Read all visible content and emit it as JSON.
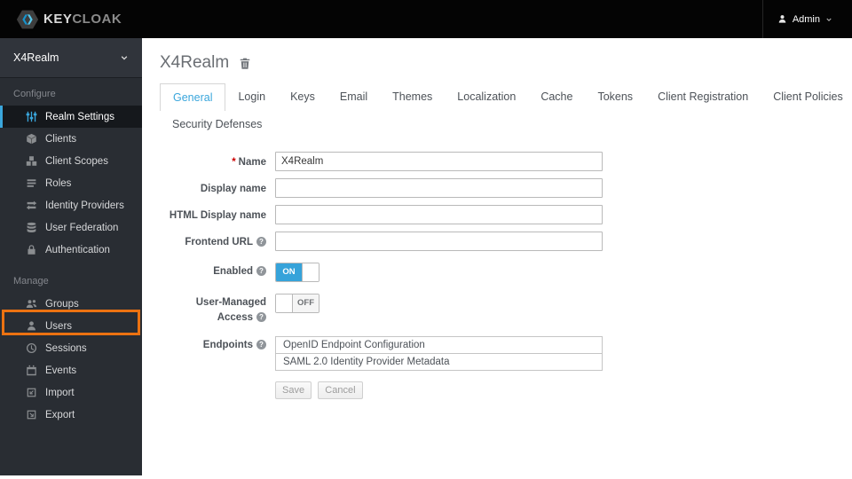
{
  "header": {
    "logo": {
      "icon": "keycloak-logo-icon",
      "text_primary": "KEY",
      "text_secondary": "CLOAK"
    },
    "user_menu": {
      "icon": "user-icon",
      "label": "Admin"
    }
  },
  "sidebar": {
    "realm_selector": {
      "label": "X4Realm"
    },
    "sections": [
      {
        "title": "Configure",
        "items": [
          {
            "label": "Realm Settings",
            "icon": "sliders-icon",
            "active": true
          },
          {
            "label": "Clients",
            "icon": "cube-icon"
          },
          {
            "label": "Client Scopes",
            "icon": "cubes-icon"
          },
          {
            "label": "Roles",
            "icon": "list-icon"
          },
          {
            "label": "Identity Providers",
            "icon": "exchange-arrows-icon"
          },
          {
            "label": "User Federation",
            "icon": "database-icon"
          },
          {
            "label": "Authentication",
            "icon": "lock-icon"
          }
        ]
      },
      {
        "title": "Manage",
        "items": [
          {
            "label": "Groups",
            "icon": "group-icon"
          },
          {
            "label": "Users",
            "icon": "user-icon",
            "highlighted": true
          },
          {
            "label": "Sessions",
            "icon": "clock-icon"
          },
          {
            "label": "Events",
            "icon": "calendar-icon"
          },
          {
            "label": "Import",
            "icon": "import-icon"
          },
          {
            "label": "Export",
            "icon": "export-icon"
          }
        ]
      }
    ]
  },
  "main": {
    "title": "X4Realm",
    "tabs": [
      {
        "label": "General",
        "active": true
      },
      {
        "label": "Login"
      },
      {
        "label": "Keys"
      },
      {
        "label": "Email"
      },
      {
        "label": "Themes"
      },
      {
        "label": "Localization"
      },
      {
        "label": "Cache"
      },
      {
        "label": "Tokens"
      },
      {
        "label": "Client Registration"
      },
      {
        "label": "Client Policies"
      },
      {
        "label": "Security Defenses"
      }
    ],
    "form": {
      "name": {
        "label": "Name",
        "value": "X4Realm"
      },
      "display_name": {
        "label": "Display name",
        "value": ""
      },
      "html_display_name": {
        "label": "HTML Display name",
        "value": ""
      },
      "frontend_url": {
        "label": "Frontend URL",
        "value": ""
      },
      "enabled": {
        "label": "Enabled",
        "state": "ON"
      },
      "user_managed_access": {
        "label": "User-Managed Access",
        "state": "OFF"
      },
      "endpoints": {
        "label": "Endpoints",
        "links": [
          "OpenID Endpoint Configuration",
          "SAML 2.0 Identity Provider Metadata"
        ]
      },
      "save_label": "Save",
      "cancel_label": "Cancel"
    }
  },
  "colors": {
    "accent_blue": "#3aa6dc",
    "toggle_blue": "#36a3da",
    "highlight_orange": "#ec7211"
  }
}
